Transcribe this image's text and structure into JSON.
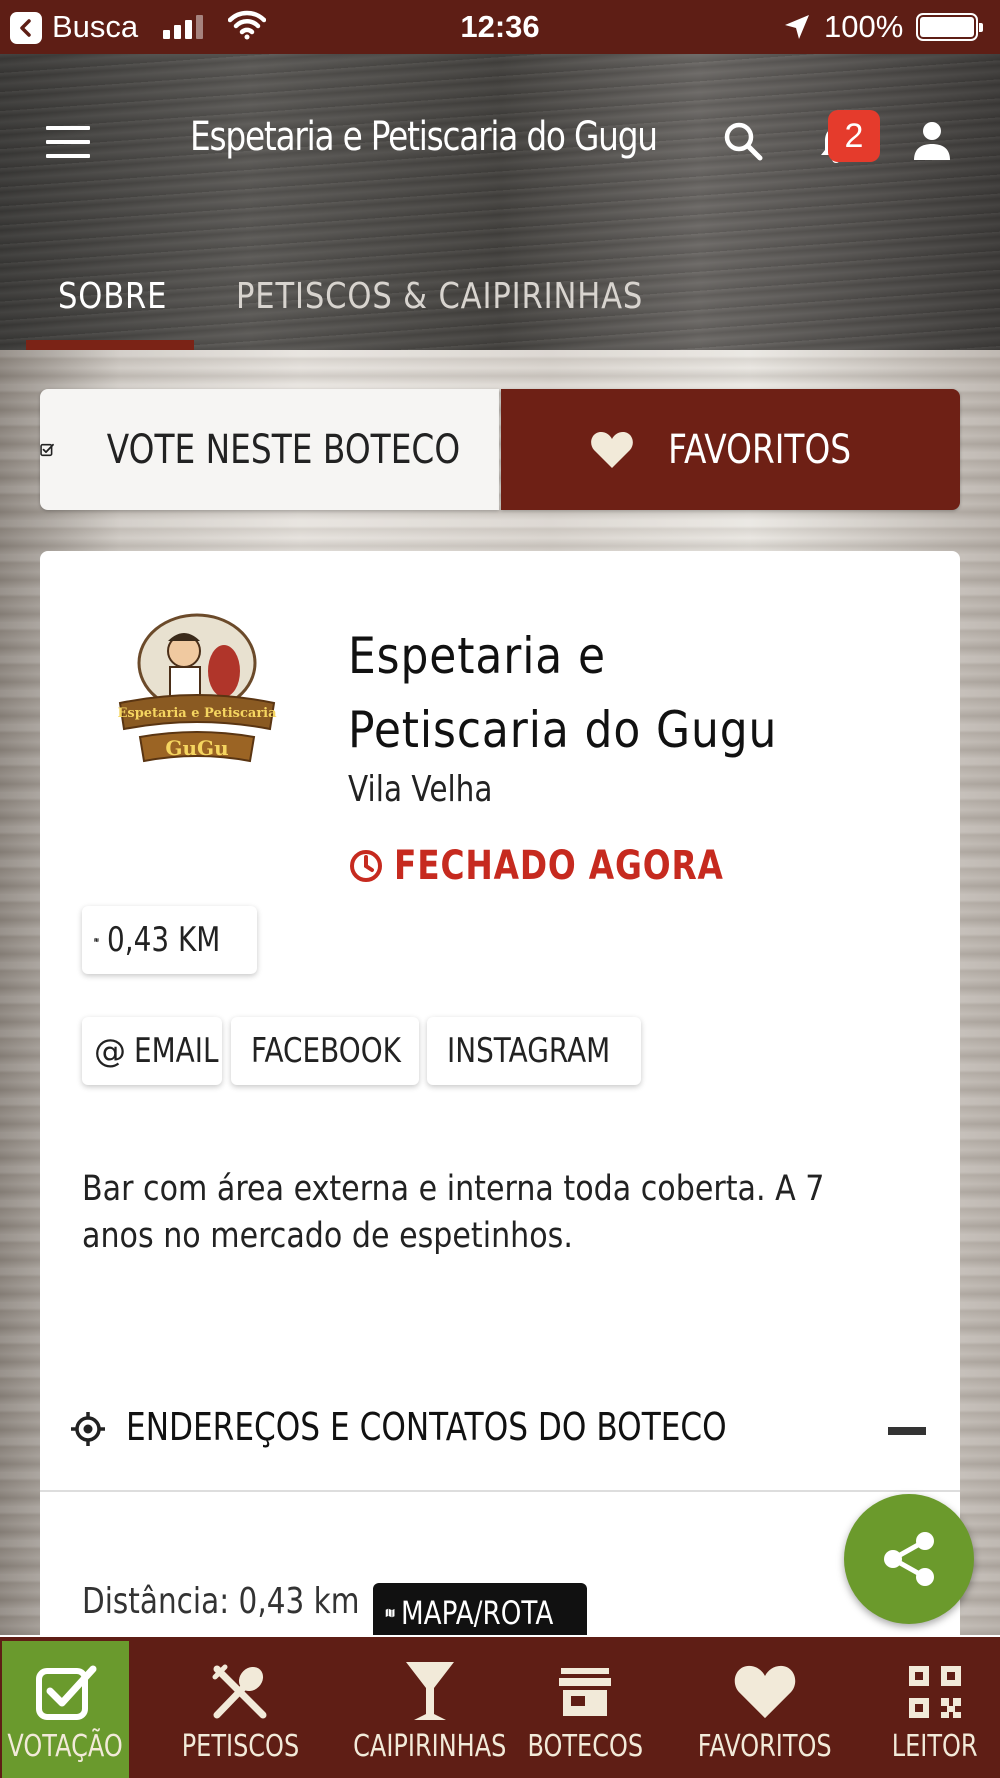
{
  "status_bar": {
    "back_label": "Busca",
    "time": "12:36",
    "battery": "100%"
  },
  "header": {
    "title": "Espetaria e Petiscaria do Gugu",
    "notification_count": "2",
    "tabs": [
      {
        "label": "SOBRE",
        "active": true
      },
      {
        "label": "PETISCOS & CAIPIRINHAS",
        "active": false
      }
    ]
  },
  "actions": {
    "vote_label": "VOTE NESTE BOTECO",
    "favorite_label": "FAVORITOS"
  },
  "venue": {
    "logo_text": "Espetaria e Petiscaria do GuGu",
    "name": "Espetaria e Petiscaria do Gugu",
    "city": "Vila Velha",
    "status": "FECHADO AGORA",
    "distance": "0,43 KM",
    "contacts": [
      {
        "label": "EMAIL",
        "icon": "at-icon"
      },
      {
        "label": "FACEBOOK",
        "icon": "facebook-icon"
      },
      {
        "label": "INSTAGRAM",
        "icon": "instagram-icon"
      }
    ],
    "description": "Bar com área externa e interna toda coberta. A 7 anos no mercado de espetinhos."
  },
  "address_section": {
    "title": "ENDEREÇOS E CONTATOS DO BOTECO",
    "distance_text": "Distância: 0,43 km",
    "map_button": "MAPA/ROTA"
  },
  "bottom_nav": [
    {
      "label": "VOTAÇÃO",
      "icon": "vote-check-icon",
      "active": true
    },
    {
      "label": "PETISCOS",
      "icon": "cutlery-icon"
    },
    {
      "label": "CAIPIRINHAS",
      "icon": "cocktail-icon"
    },
    {
      "label": "BOTECOS",
      "icon": "store-icon"
    },
    {
      "label": "FAVORITOS",
      "icon": "heart-icon"
    },
    {
      "label": "LEITOR",
      "icon": "qr-code-icon"
    }
  ],
  "colors": {
    "brand_dark": "#5f1e15",
    "favorite_button": "#6e2015",
    "status_closed": "#c62a1f",
    "active_green": "#6a9a2d",
    "badge_red": "#e53b2c"
  }
}
